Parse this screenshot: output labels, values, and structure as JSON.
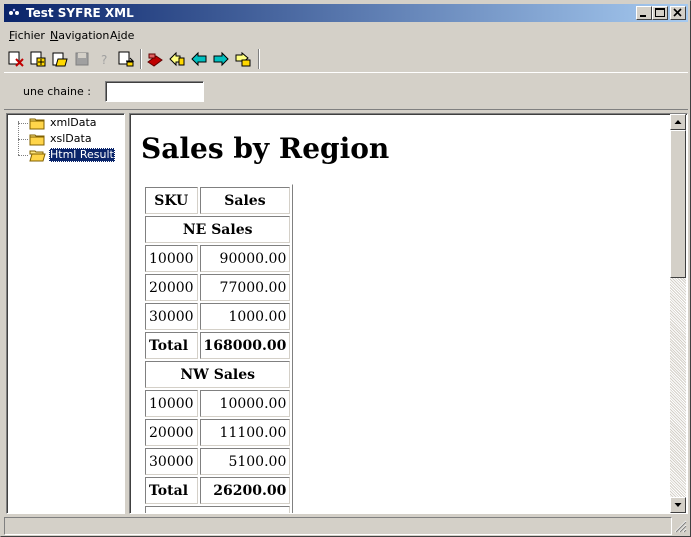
{
  "window": {
    "title": "Test SYFRE XML"
  },
  "menu": [
    {
      "label": "Fichier",
      "accel": "F"
    },
    {
      "label": "Navigation",
      "accel": "N"
    },
    {
      "label": "Aide",
      "accel": "i"
    }
  ],
  "toolbar": {
    "buttons": [
      {
        "name": "close-doc",
        "icon": "close-doc-icon"
      },
      {
        "name": "new-doc",
        "icon": "new-doc-icon"
      },
      {
        "name": "open-doc",
        "icon": "open-doc-icon"
      },
      {
        "name": "save",
        "icon": "save-icon"
      },
      {
        "name": "help",
        "icon": "help-icon"
      },
      {
        "name": "export",
        "icon": "export-icon"
      },
      {
        "name": "transform",
        "icon": "transform-icon"
      },
      {
        "name": "home",
        "icon": "home-icon"
      },
      {
        "name": "back",
        "icon": "back-arrow-icon"
      },
      {
        "name": "forward",
        "icon": "forward-arrow-icon"
      },
      {
        "name": "go",
        "icon": "go-icon"
      }
    ]
  },
  "params": {
    "label": "une chaine :",
    "value": ""
  },
  "tree": {
    "items": [
      {
        "label": "xmlData",
        "selected": false
      },
      {
        "label": "xslData",
        "selected": false
      },
      {
        "label": "Html Result",
        "selected": true
      }
    ]
  },
  "result": {
    "title": "Sales by Region",
    "headers": [
      "SKU",
      "Sales"
    ],
    "groups": [
      {
        "name": "NE Sales",
        "rows": [
          {
            "sku": "10000",
            "sales": "90000.00"
          },
          {
            "sku": "20000",
            "sales": "77000.00"
          },
          {
            "sku": "30000",
            "sales": "1000.00"
          }
        ],
        "total_label": "Total",
        "total": "168000.00"
      },
      {
        "name": "NW Sales",
        "rows": [
          {
            "sku": "10000",
            "sales": "10000.00"
          },
          {
            "sku": "20000",
            "sales": "11100.00"
          },
          {
            "sku": "30000",
            "sales": "5100.00"
          }
        ],
        "total_label": "Total",
        "total": "26200.00"
      }
    ]
  },
  "colors": {
    "titlebar_start": "#0a246a",
    "titlebar_end": "#a6caf0",
    "selection": "#0a246a",
    "face": "#d4d0c8"
  }
}
